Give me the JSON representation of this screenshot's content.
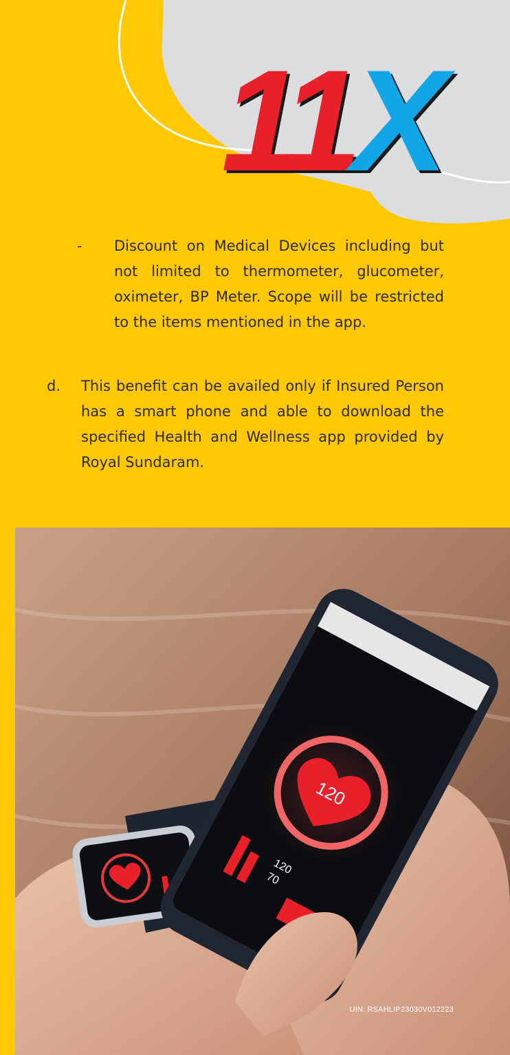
{
  "header": {
    "logo_text_ones": "11",
    "logo_text_x": "X",
    "colors": {
      "background": "#FFC805",
      "cloud": "#DCDDDF",
      "red": "#E8202A",
      "blue_light": "#12A6E6",
      "blue_dark": "#0B4D9B"
    }
  },
  "content": {
    "bullet": {
      "marker": "-",
      "text": "Discount on Medical Devices including but not limited to thermometer, glucometer, oximeter, BP Meter. Scope will be restricted to the items mentioned in the app."
    },
    "item_d": {
      "marker": "d.",
      "text": "This benefit can be availed only if Insured Person has a smart phone and able to download the specified Health and Wellness app provided by Royal Sundaram."
    }
  },
  "photo": {
    "phone_reading": "120",
    "phone_stat_1": "120",
    "phone_stat_2": "70",
    "uin": "UIN: RSAHLIP23030V012223"
  }
}
